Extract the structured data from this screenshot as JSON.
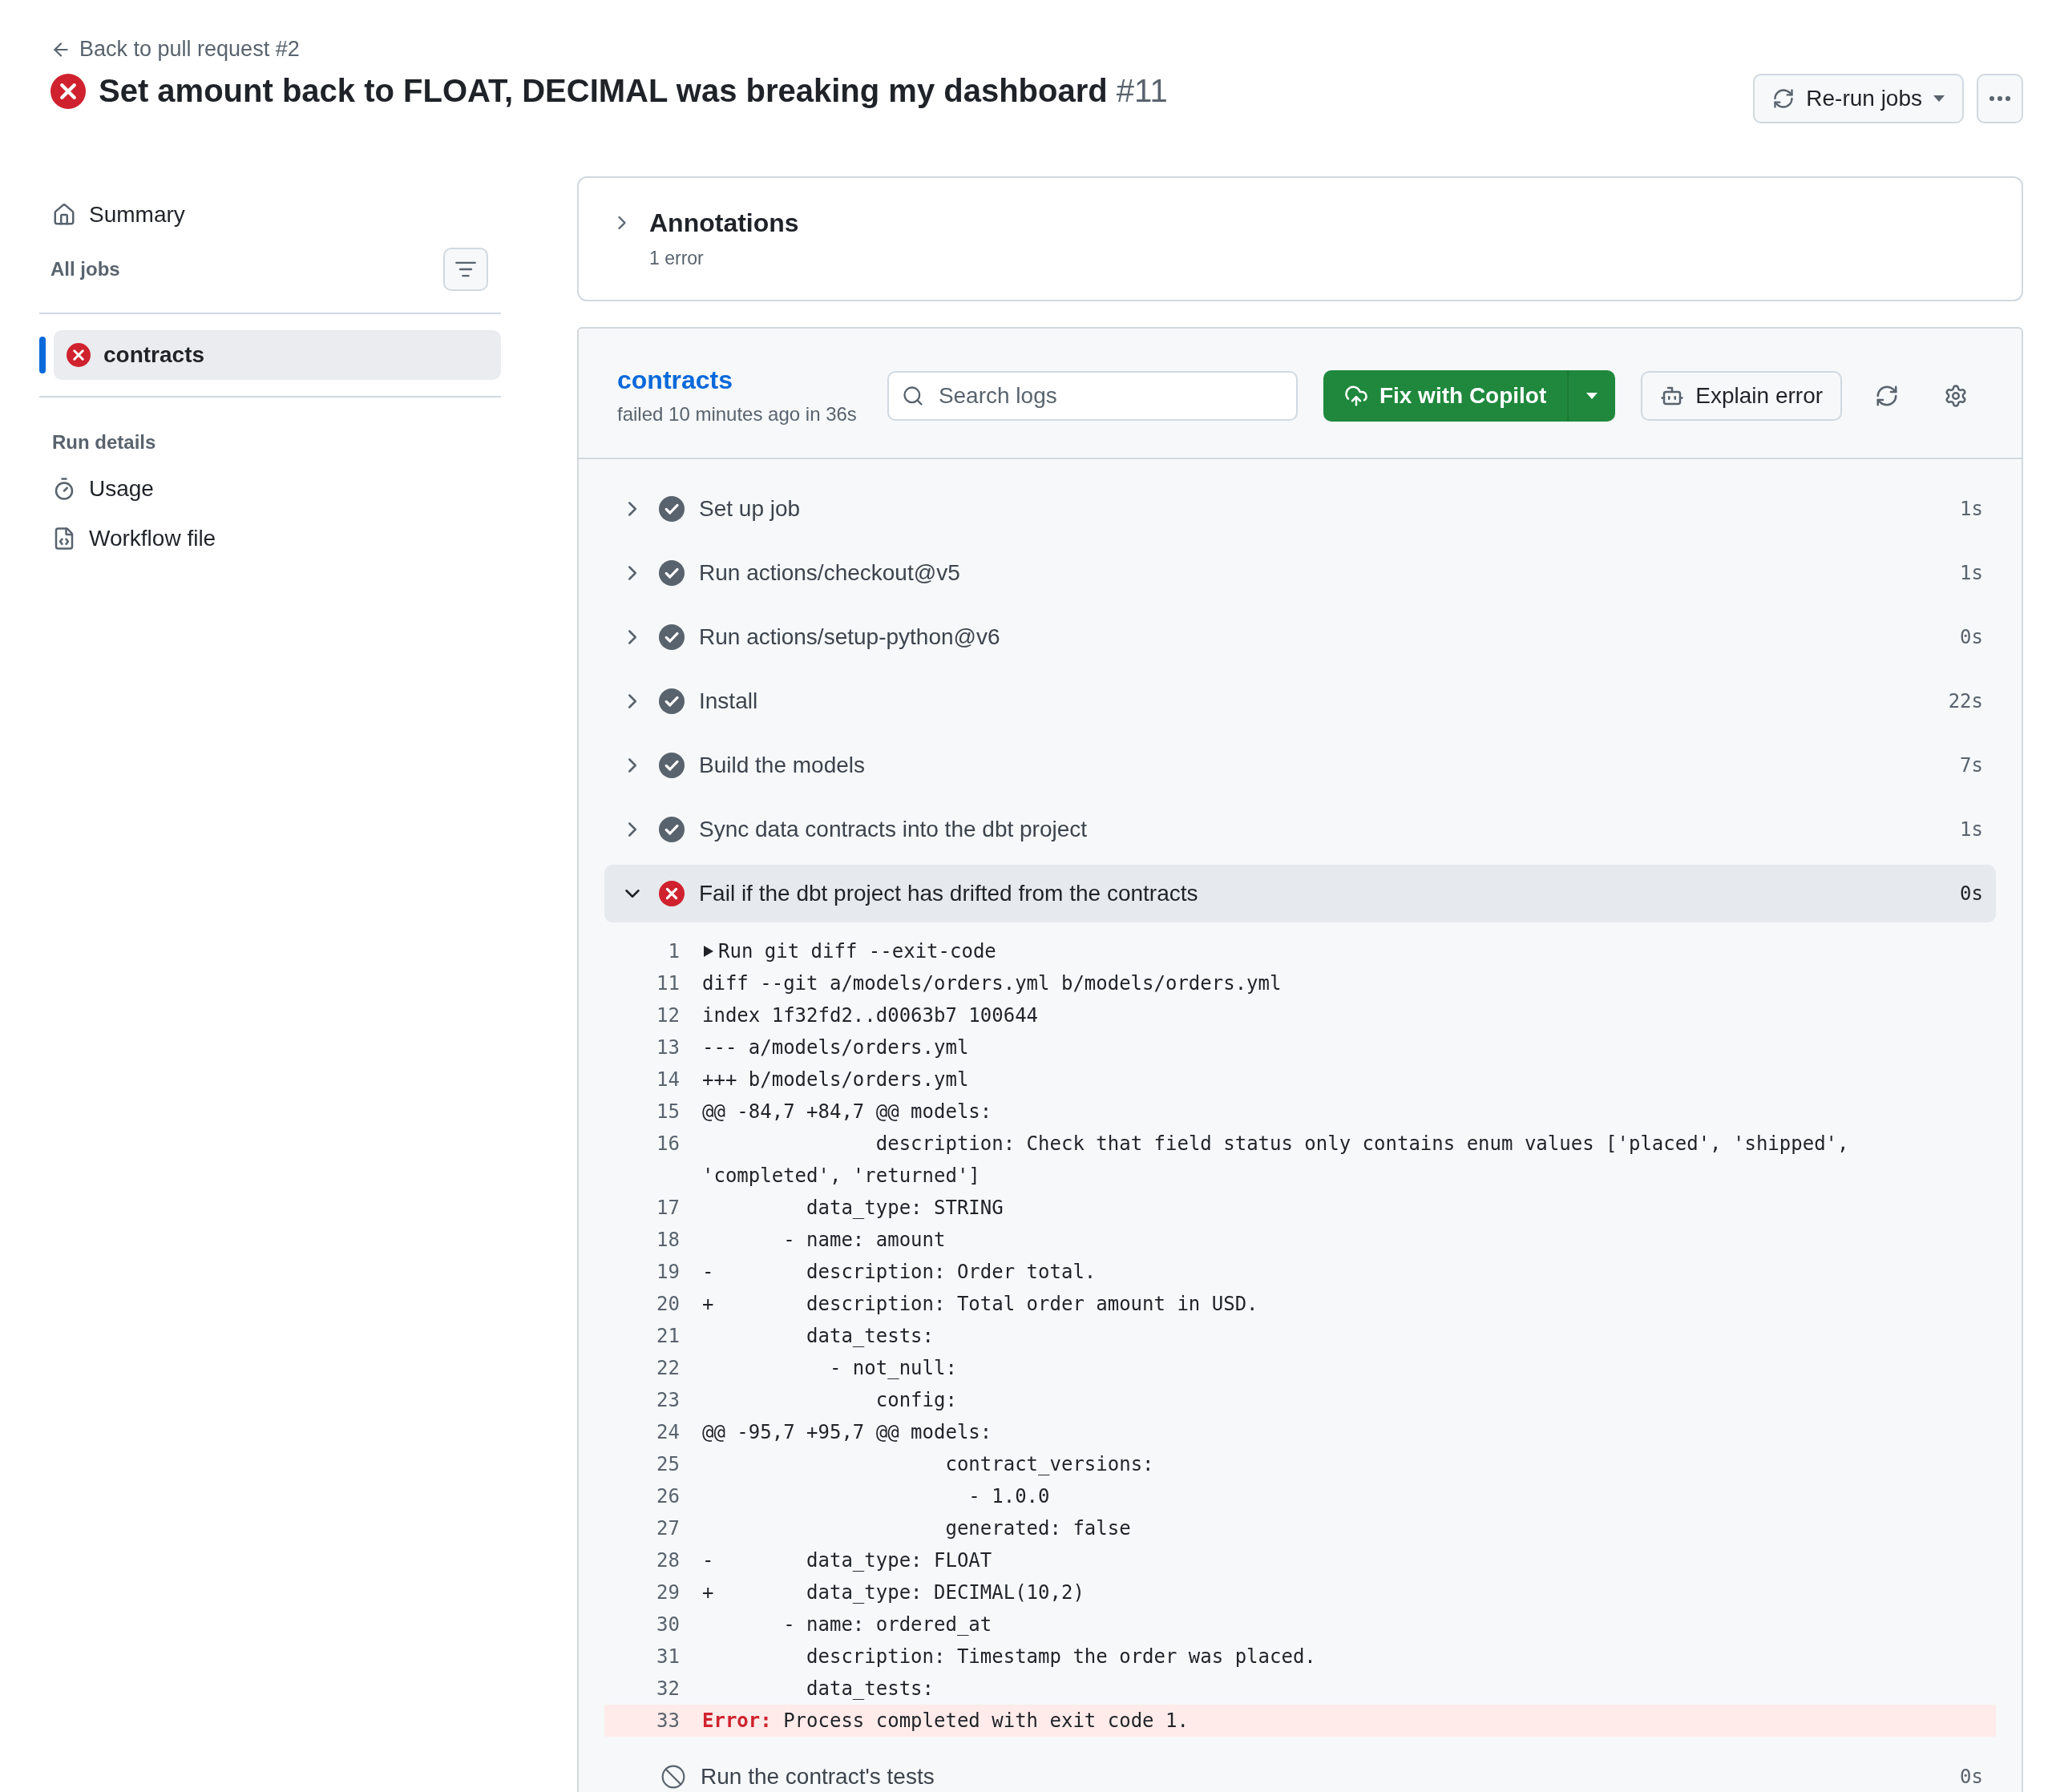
{
  "header": {
    "back_link": "Back to pull request #2",
    "kind": "failure",
    "title": "Set amount back to FLOAT, DECIMAL was breaking my dashboard",
    "run_number": "#11",
    "rerun_button": "Re-run jobs"
  },
  "sidebar": {
    "summary": "Summary",
    "jobs_heading": "All jobs",
    "jobs": [
      {
        "name": "contracts",
        "kind": "failure",
        "selected": true
      }
    ],
    "run_details_heading": "Run details",
    "run_details": [
      {
        "label": "Usage",
        "kind": "usage"
      },
      {
        "label": "Workflow file",
        "kind": "workflow"
      }
    ]
  },
  "annotations": {
    "title": "Annotations",
    "count": "1 error",
    "expanded": false
  },
  "job": {
    "name": "contracts",
    "meta": "failed 10 minutes ago in 36s",
    "search_placeholder": "Search logs",
    "fix_button": "Fix with Copilot",
    "explain_button": "Explain error",
    "steps": [
      {
        "name": "Set up job",
        "kind": "success",
        "duration": "1s",
        "expanded": false
      },
      {
        "name": "Run actions/checkout@v5",
        "kind": "success",
        "duration": "1s",
        "expanded": false
      },
      {
        "name": "Run actions/setup-python@v6",
        "kind": "success",
        "duration": "0s",
        "expanded": false
      },
      {
        "name": "Install",
        "kind": "success",
        "duration": "22s",
        "expanded": false
      },
      {
        "name": "Build the models",
        "kind": "success",
        "duration": "7s",
        "expanded": false
      },
      {
        "name": "Sync data contracts into the dbt project",
        "kind": "success",
        "duration": "1s",
        "expanded": false
      },
      {
        "name": "Fail if the dbt project has drifted from the contracts",
        "kind": "failure",
        "duration": "0s",
        "expanded": true,
        "log": [
          {
            "number": "1",
            "kind": "group",
            "text": "Run git diff --exit-code"
          },
          {
            "number": "11",
            "kind": "normal",
            "text": "diff --git a/models/orders.yml b/models/orders.yml"
          },
          {
            "number": "12",
            "kind": "normal",
            "text": "index 1f32fd2..d0063b7 100644"
          },
          {
            "number": "13",
            "kind": "normal",
            "text": "--- a/models/orders.yml"
          },
          {
            "number": "14",
            "kind": "normal",
            "text": "+++ b/models/orders.yml"
          },
          {
            "number": "15",
            "kind": "normal",
            "text": "@@ -84,7 +84,7 @@ models:"
          },
          {
            "number": "16",
            "kind": "normal",
            "text": "               description: Check that field status only contains enum values ['placed', 'shipped', 'completed', 'returned']"
          },
          {
            "number": "17",
            "kind": "normal",
            "text": "         data_type: STRING"
          },
          {
            "number": "18",
            "kind": "normal",
            "text": "       - name: amount"
          },
          {
            "number": "19",
            "kind": "normal",
            "text": "-        description: Order total."
          },
          {
            "number": "20",
            "kind": "normal",
            "text": "+        description: Total order amount in USD."
          },
          {
            "number": "21",
            "kind": "normal",
            "text": "         data_tests:"
          },
          {
            "number": "22",
            "kind": "normal",
            "text": "           - not_null:"
          },
          {
            "number": "23",
            "kind": "normal",
            "text": "               config:"
          },
          {
            "number": "24",
            "kind": "normal",
            "text": "@@ -95,7 +95,7 @@ models:"
          },
          {
            "number": "25",
            "kind": "normal",
            "text": "                     contract_versions:"
          },
          {
            "number": "26",
            "kind": "normal",
            "text": "                       - 1.0.0"
          },
          {
            "number": "27",
            "kind": "normal",
            "text": "                     generated: false"
          },
          {
            "number": "28",
            "kind": "normal",
            "text": "-        data_type: FLOAT"
          },
          {
            "number": "29",
            "kind": "normal",
            "text": "+        data_type: DECIMAL(10,2)"
          },
          {
            "number": "30",
            "kind": "normal",
            "text": "       - name: ordered_at"
          },
          {
            "number": "31",
            "kind": "normal",
            "text": "         description: Timestamp the order was placed."
          },
          {
            "number": "32",
            "kind": "normal",
            "text": "         data_tests:"
          },
          {
            "number": "33",
            "kind": "error",
            "text": "**Error:** Process completed with exit code 1."
          }
        ]
      },
      {
        "name": "Run the contract's tests",
        "kind": "skipped",
        "duration": "0s",
        "expanded": false
      }
    ]
  }
}
